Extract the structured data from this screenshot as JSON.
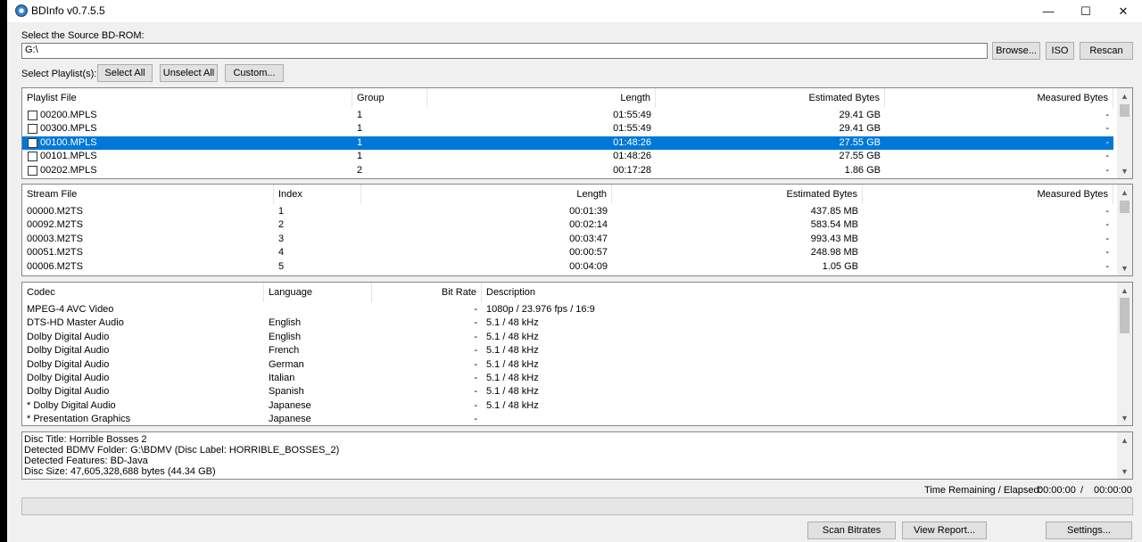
{
  "window": {
    "title": "BDInfo v0.7.5.5",
    "minimize": "—",
    "maximize": "☐",
    "close": "✕"
  },
  "source": {
    "label": "Select the Source BD-ROM:",
    "path": "G:\\",
    "browse_label": "Browse...",
    "iso_label": "ISO",
    "rescan_label": "Rescan"
  },
  "playlist_controls": {
    "label": "Select Playlist(s):",
    "select_all": "Select All",
    "unselect_all": "Unselect All",
    "custom": "Custom..."
  },
  "playlists": {
    "headers": [
      "Playlist File",
      "Group",
      "Length",
      "Estimated Bytes",
      "Measured Bytes"
    ],
    "rows": [
      {
        "file": "00200.MPLS",
        "group": "1",
        "length": "01:55:49",
        "est": "29.41 GB",
        "meas": "-"
      },
      {
        "file": "00300.MPLS",
        "group": "1",
        "length": "01:55:49",
        "est": "29.41 GB",
        "meas": "-"
      },
      {
        "file": "00100.MPLS",
        "group": "1",
        "length": "01:48:26",
        "est": "27.55 GB",
        "meas": "-"
      },
      {
        "file": "00101.MPLS",
        "group": "1",
        "length": "01:48:26",
        "est": "27.55 GB",
        "meas": "-"
      },
      {
        "file": "00202.MPLS",
        "group": "2",
        "length": "00:17:28",
        "est": "1.86 GB",
        "meas": "-"
      }
    ],
    "selected_index": 2
  },
  "streams": {
    "headers": [
      "Stream File",
      "Index",
      "Length",
      "Estimated Bytes",
      "Measured Bytes"
    ],
    "rows": [
      {
        "file": "00000.M2TS",
        "index": "1",
        "length": "00:01:39",
        "est": "437.85 MB",
        "meas": "-"
      },
      {
        "file": "00092.M2TS",
        "index": "2",
        "length": "00:02:14",
        "est": "583.54 MB",
        "meas": "-"
      },
      {
        "file": "00003.M2TS",
        "index": "3",
        "length": "00:03:47",
        "est": "993.43 MB",
        "meas": "-"
      },
      {
        "file": "00051.M2TS",
        "index": "4",
        "length": "00:00:57",
        "est": "248.98 MB",
        "meas": "-"
      },
      {
        "file": "00006.M2TS",
        "index": "5",
        "length": "00:04:09",
        "est": "1.05 GB",
        "meas": "-"
      }
    ]
  },
  "codecs": {
    "headers": [
      "Codec",
      "Language",
      "Bit Rate",
      "Description"
    ],
    "rows": [
      {
        "codec": "MPEG-4 AVC Video",
        "lang": "",
        "bitrate": "-",
        "desc": "1080p / 23.976 fps / 16:9"
      },
      {
        "codec": "DTS-HD Master Audio",
        "lang": "English",
        "bitrate": "-",
        "desc": "5.1 / 48 kHz"
      },
      {
        "codec": "Dolby Digital Audio",
        "lang": "English",
        "bitrate": "-",
        "desc": "5.1 / 48 kHz"
      },
      {
        "codec": "Dolby Digital Audio",
        "lang": "French",
        "bitrate": "-",
        "desc": "5.1 / 48 kHz"
      },
      {
        "codec": "Dolby Digital Audio",
        "lang": "German",
        "bitrate": "-",
        "desc": "5.1 / 48 kHz"
      },
      {
        "codec": "Dolby Digital Audio",
        "lang": "Italian",
        "bitrate": "-",
        "desc": "5.1 / 48 kHz"
      },
      {
        "codec": "Dolby Digital Audio",
        "lang": "Spanish",
        "bitrate": "-",
        "desc": "5.1 / 48 kHz"
      },
      {
        "codec": "* Dolby Digital Audio",
        "lang": "Japanese",
        "bitrate": "-",
        "desc": "5.1 / 48 kHz"
      },
      {
        "codec": "* Presentation Graphics",
        "lang": "Japanese",
        "bitrate": "-",
        "desc": ""
      }
    ]
  },
  "disc_info": [
    "Disc Title: Horrible Bosses 2",
    "Detected BDMV Folder: G:\\BDMV (Disc Label: HORRIBLE_BOSSES_2)",
    "Detected Features: BD-Java",
    "Disc Size: 47,605,328,688 bytes (44.34 GB)"
  ],
  "status": {
    "time_label": "Time Remaining / Elapsed:",
    "remaining": "00:00:00",
    "separator": "/",
    "elapsed": "00:00:00",
    "progress": 0
  },
  "footer": {
    "scan_bitrates": "Scan Bitrates",
    "view_report": "View Report...",
    "settings": "Settings..."
  },
  "icons": {
    "app": "disc-icon",
    "scroll_up": "▲",
    "scroll_down": "▼"
  }
}
